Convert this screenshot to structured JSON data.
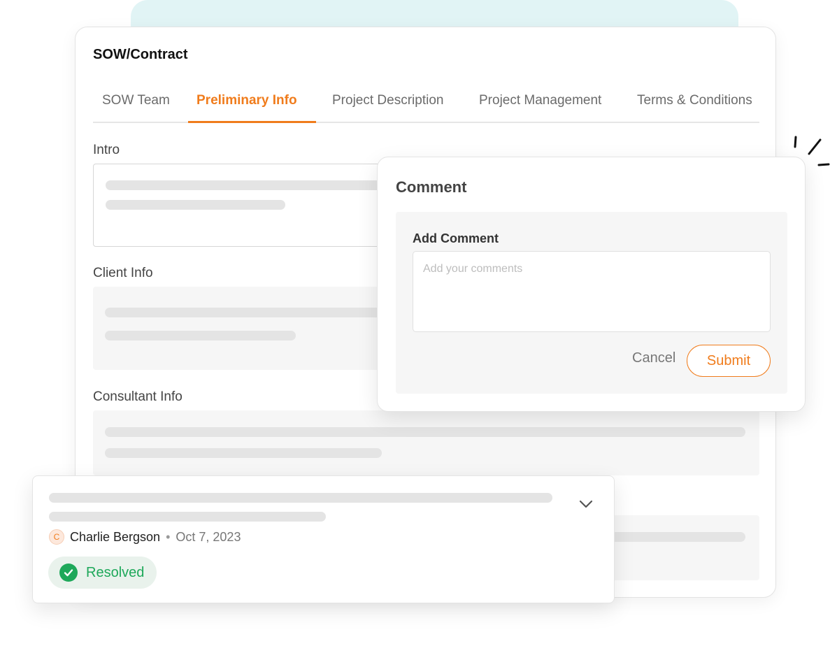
{
  "card": {
    "title": "SOW/Contract",
    "tabs": [
      {
        "label": "SOW Team",
        "active": false
      },
      {
        "label": "Preliminary Info",
        "active": true
      },
      {
        "label": "Project Description",
        "active": false
      },
      {
        "label": "Project Management",
        "active": false
      },
      {
        "label": "Terms & Conditions",
        "active": false
      }
    ],
    "sections": {
      "intro": "Intro",
      "client_info": "Client Info",
      "consultant_info": "Consultant Info"
    }
  },
  "comment_popup": {
    "title": "Comment",
    "add_label": "Add Comment",
    "input_placeholder": "Add your comments",
    "input_value": "",
    "cancel_label": "Cancel",
    "submit_label": "Submit"
  },
  "thread": {
    "author_initial": "C",
    "author": "Charlie Bergson",
    "separator": "•",
    "date": "Oct 7, 2023",
    "status": "Resolved",
    "expand_icon": "chevron-down-icon"
  },
  "colors": {
    "accent": "#f07c1c",
    "resolved": "#1ea85a",
    "header_band": "#e1f4f5"
  }
}
